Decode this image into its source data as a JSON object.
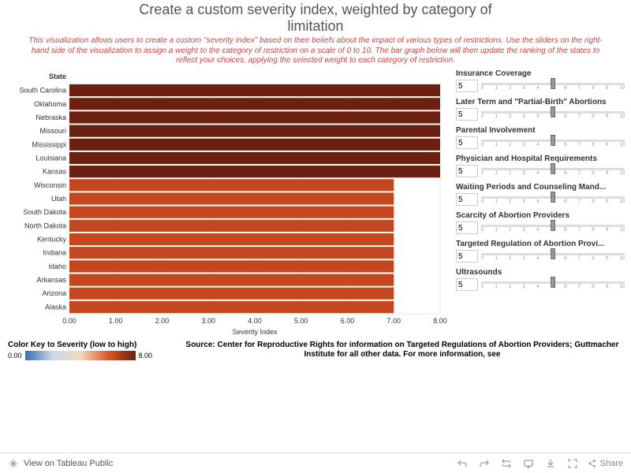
{
  "title": "Create a custom severity index, weighted by category of",
  "title_line2": "limitation",
  "description": "This visualization allows users to create a custom \"severity index\" based on their beliefs about the impact of various types of restrictions. Use the sliders on the right-hand side of the visualization to assign a weight to the category of restriction on a scale of 0 to 10. The bar graph below will then update the ranking of the states to reflect your choices, applying the selected weight to each category of restriction.",
  "chart_header": "State",
  "axis_title": "Severity Index",
  "axis_ticks": [
    "0.00",
    "1.00",
    "2.00",
    "3.00",
    "4.00",
    "5.00",
    "6.00",
    "7.00",
    "8.00"
  ],
  "chart_data": {
    "type": "bar",
    "orientation": "horizontal",
    "xlabel": "Severity Index",
    "ylabel": "State",
    "xlim": [
      0,
      8
    ],
    "categories": [
      "South Carolina",
      "Oklahoma",
      "Nebraska",
      "Missouri",
      "Mississippi",
      "Louisiana",
      "Kansas",
      "Wisconsin",
      "Utah",
      "South Dakota",
      "North Dakota",
      "Kentucky",
      "Indiana",
      "Idaho",
      "Arkansas",
      "Arizona",
      "Alaska"
    ],
    "values": [
      8.0,
      8.0,
      8.0,
      8.0,
      8.0,
      8.0,
      8.0,
      7.0,
      7.0,
      7.0,
      7.0,
      7.0,
      7.0,
      7.0,
      7.0,
      7.0,
      7.0
    ],
    "colors": [
      "#6b2010",
      "#6b2010",
      "#6b2010",
      "#6b2010",
      "#6b2010",
      "#6b2010",
      "#6b2010",
      "#c4481f",
      "#c4481f",
      "#c4481f",
      "#c4481f",
      "#c4481f",
      "#c4481f",
      "#c4481f",
      "#c4481f",
      "#c4481f",
      "#c4481f"
    ]
  },
  "sliders": [
    {
      "label": "Insurance Coverage",
      "value": "5"
    },
    {
      "label": "Later Term and \"Partial-Birth\" Abortions",
      "value": "5"
    },
    {
      "label": "Parental Involvement",
      "value": "5"
    },
    {
      "label": "Physician and Hospital Requirements",
      "value": "5"
    },
    {
      "label": "Waiting Periods and Counseling Mand...",
      "value": "5"
    },
    {
      "label": "Scarcity of Abortion Providers",
      "value": "5"
    },
    {
      "label": "Targeted Regulation of Abortion Provi...",
      "value": "5"
    },
    {
      "label": "Ultrasounds",
      "value": "5"
    }
  ],
  "slider_ticks": [
    "0",
    "1",
    "2",
    "3",
    "4",
    "5",
    "6",
    "7",
    "8",
    "9",
    "10"
  ],
  "legend_title": "Color Key to Severity (low to high)",
  "legend_min": "0.00",
  "legend_max": "8.00",
  "source": "Source: Center for Reproductive Rights for information on Targeted Regulations of Abortion Providers;  Guttmacher Institute for all other data. For more information, see",
  "footer_view": "View on Tableau Public",
  "footer_share": "Share"
}
